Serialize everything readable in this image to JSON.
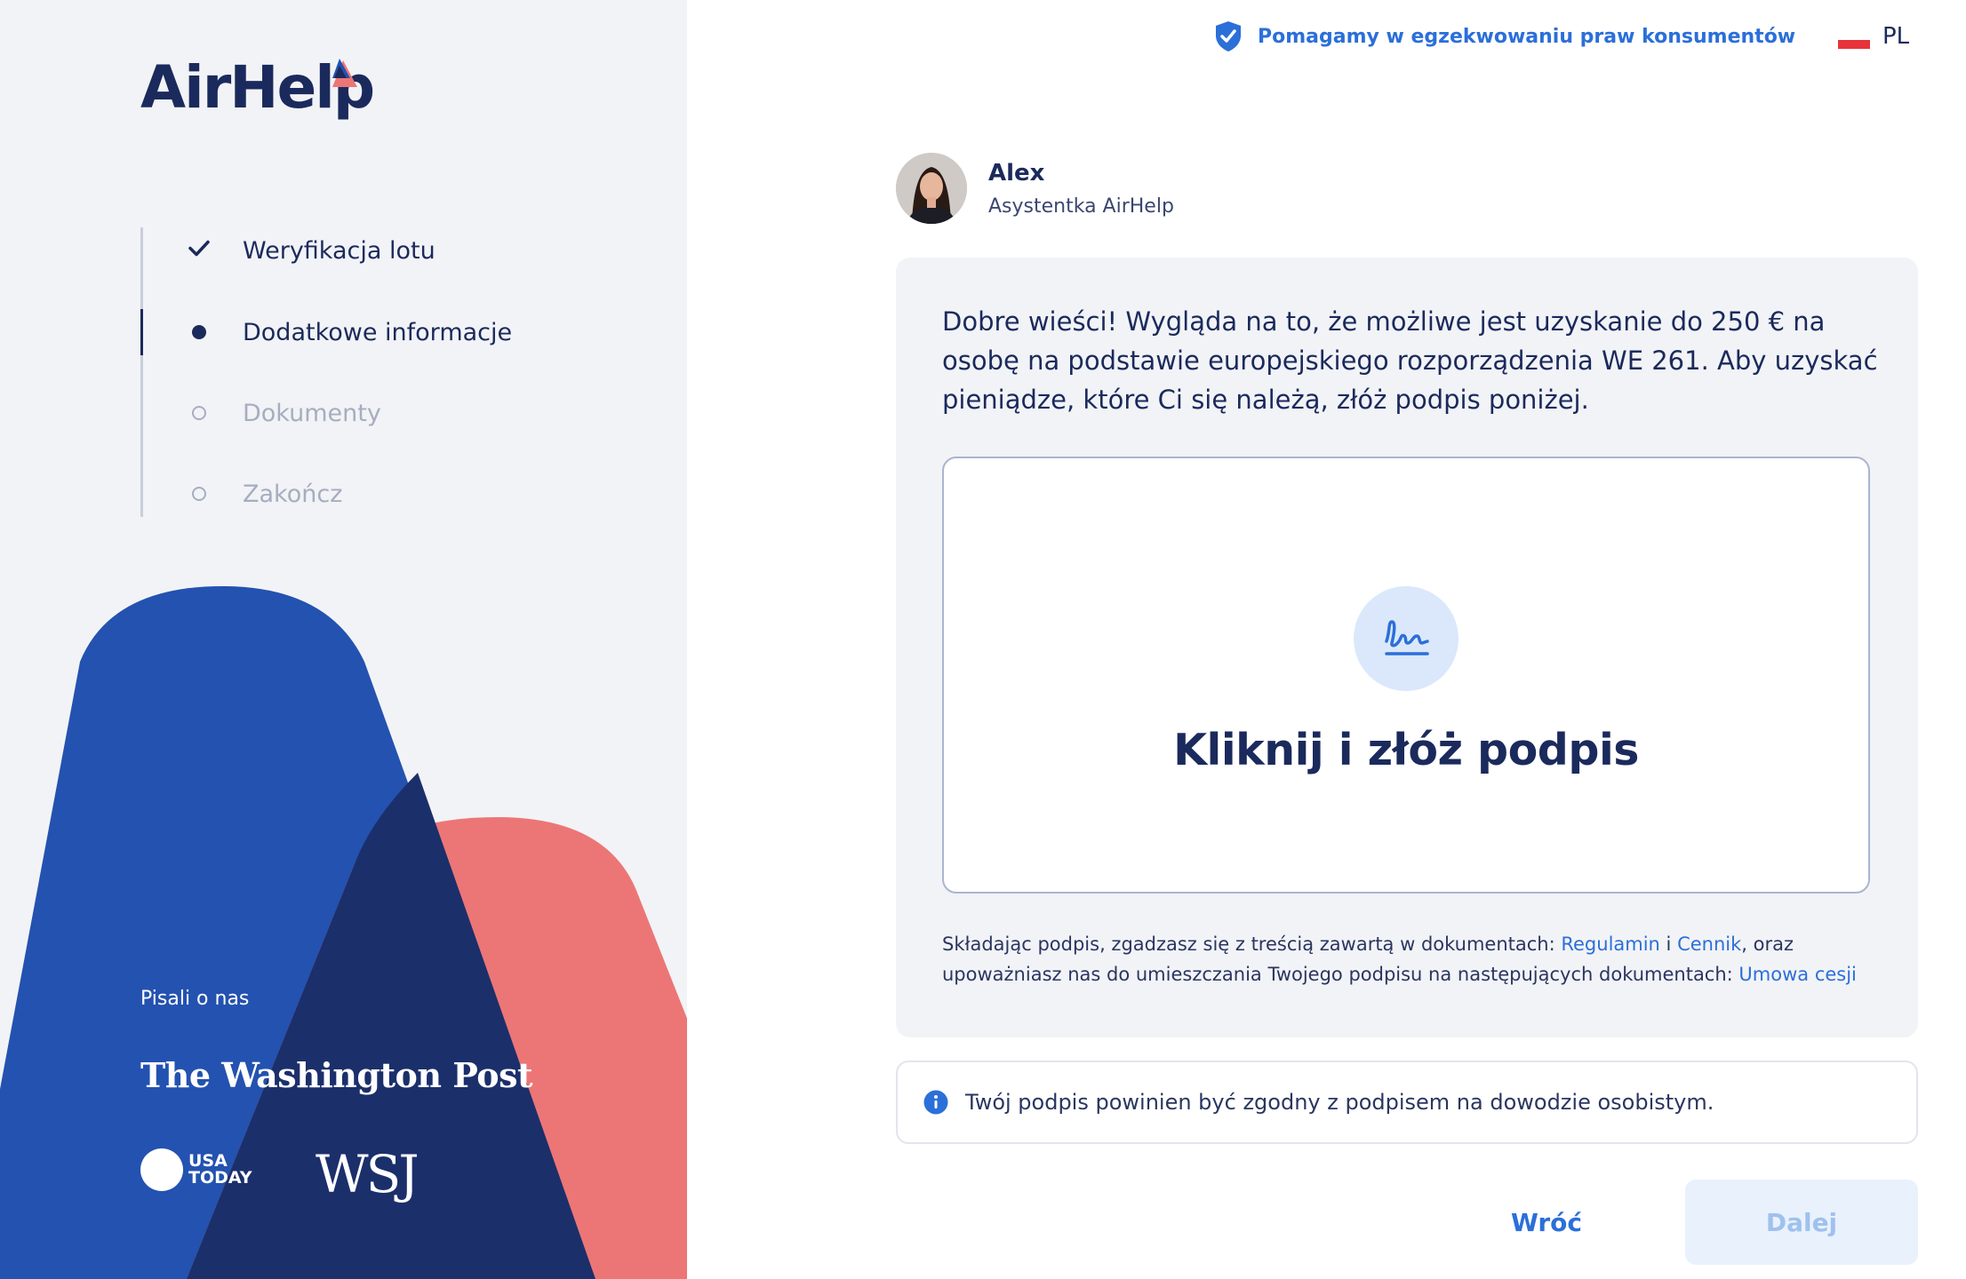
{
  "brand": {
    "name": "AirHelp"
  },
  "header": {
    "trust_text": "Pomagamy w egzekwowaniu praw konsumentów",
    "language_code": "PL"
  },
  "steps": [
    {
      "label": "Weryfikacja lotu",
      "state": "done"
    },
    {
      "label": "Dodatkowe informacje",
      "state": "active"
    },
    {
      "label": "Dokumenty",
      "state": "pending"
    },
    {
      "label": "Zakończ",
      "state": "pending"
    }
  ],
  "press": {
    "label": "Pisali o nas",
    "outlets": [
      "The Washington Post",
      "USA TODAY",
      "WSJ"
    ],
    "usa_today_line1": "USA",
    "usa_today_line2": "TODAY"
  },
  "assistant": {
    "name": "Alex",
    "role": "Asystentka AirHelp"
  },
  "card": {
    "message": "Dobre wieści! Wygląda na to, że możliwe jest uzyskanie do 250 € na osobę na podstawie europejskiego rozporządzenia WE 261. Aby uzyskać pieniądze, które Ci się należą, złóż podpis poniżej.",
    "signature_prompt": "Kliknij i złóż podpis",
    "legal_part1": "Składając podpis, zgadzasz się z treścią zawartą w dokumentach: ",
    "legal_link_terms": "Regulamin",
    "legal_and": " i ",
    "legal_link_pricing": "Cennik",
    "legal_part2": ", oraz upoważniasz nas do umieszczania Twojego podpisu na następujących dokumentach: ",
    "legal_link_assignment": "Umowa cesji"
  },
  "note": {
    "text": "Twój podpis powinien być zgodny z podpisem na dowodzie osobistym."
  },
  "actions": {
    "back_label": "Wróć",
    "next_label": "Dalej"
  },
  "colors": {
    "navy": "#1b2a5c",
    "accent_blue": "#2b6fd9",
    "shape_blue": "#2352b0",
    "shape_navy": "#1b2f6b",
    "shape_coral": "#ec7676",
    "panel_bg": "#f2f3f6"
  },
  "icons": {
    "trust": "shield-check-icon",
    "signature": "signature-icon",
    "info": "info-icon",
    "done": "checkmark-icon"
  }
}
